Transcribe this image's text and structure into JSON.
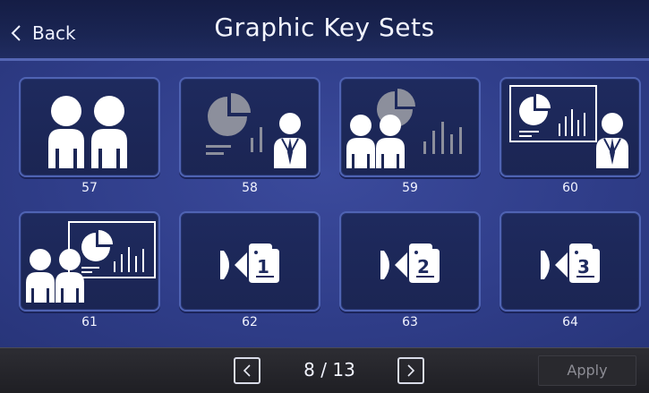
{
  "header": {
    "back_label": "Back",
    "title": "Graphic Key Sets"
  },
  "tiles": [
    {
      "label": "57",
      "icon": "two-persons-icon"
    },
    {
      "label": "58",
      "icon": "presenter-pie-chart-icon"
    },
    {
      "label": "59",
      "icon": "two-persons-pie-chart-icon"
    },
    {
      "label": "60",
      "icon": "presenter-screen-icon"
    },
    {
      "label": "61",
      "icon": "two-persons-screen-icon"
    },
    {
      "label": "62",
      "icon": "camera-1-icon"
    },
    {
      "label": "63",
      "icon": "camera-2-icon"
    },
    {
      "label": "64",
      "icon": "camera-3-icon"
    }
  ],
  "camera_numbers": [
    "1",
    "2",
    "3"
  ],
  "pagination": {
    "current": "8 / 13",
    "prev_icon": "chevron-left-icon",
    "next_icon": "chevron-right-icon"
  },
  "footer": {
    "apply_label": "Apply"
  },
  "colors": {
    "header_bg": "#1a2553",
    "grid_bg": "#303e8a",
    "tile_bg": "#1e2a5e",
    "tile_border": "#4f63b3",
    "footer_bg": "#252529"
  }
}
